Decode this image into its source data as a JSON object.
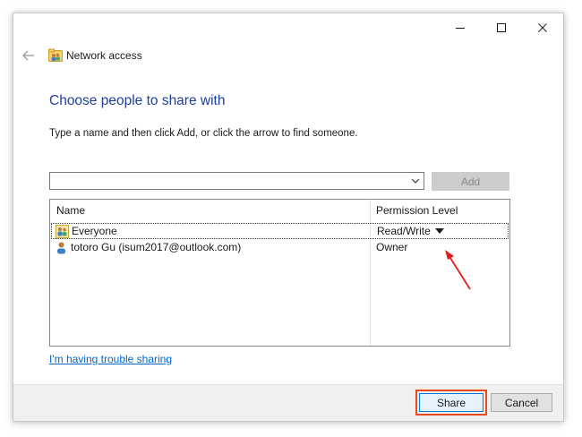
{
  "window": {
    "title": "Network access",
    "controls": [
      "minimize-icon",
      "maximize-icon",
      "close-icon"
    ]
  },
  "page": {
    "heading": "Choose people to share with",
    "instructions": "Type a name and then click Add, or click the arrow to find someone."
  },
  "name_combo": {
    "value": ""
  },
  "add_button": {
    "label": "Add",
    "enabled": false
  },
  "list": {
    "columns": [
      "Name",
      "Permission Level"
    ],
    "rows": [
      {
        "icon": "group-users-icon",
        "name": "Everyone",
        "permission": "Read/Write",
        "has_dropdown": true,
        "selected": true
      },
      {
        "icon": "user-icon",
        "name": "totoro Gu (isum2017@outlook.com)",
        "permission": "Owner",
        "has_dropdown": false,
        "selected": false
      }
    ]
  },
  "trouble_link": "I'm having trouble sharing",
  "footer": {
    "share_label": "Share",
    "cancel_label": "Cancel"
  },
  "colors": {
    "heading": "#1f3f99",
    "link": "#0066cc",
    "annotation_red": "#e8481b",
    "primary_button_border": "#0078d7"
  }
}
